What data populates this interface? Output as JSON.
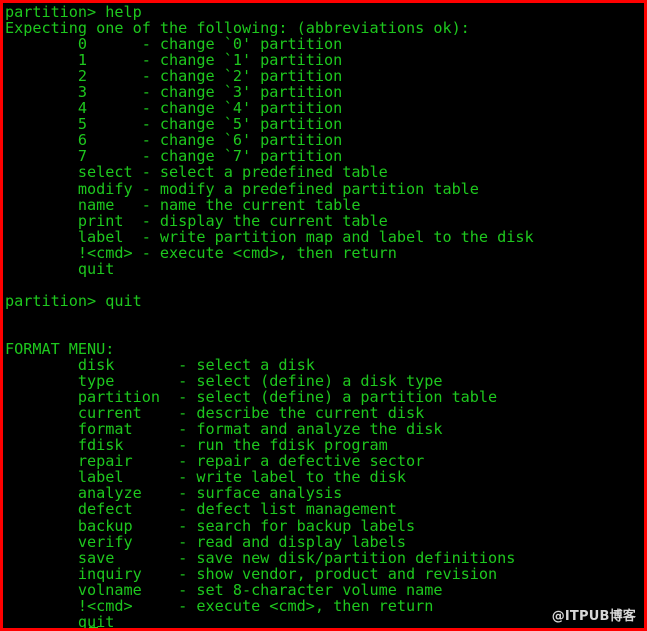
{
  "window": {
    "type": "terminal-emulator",
    "border_color": "#ff0000",
    "background_color": "#000000",
    "foreground_color": "#1ec81e"
  },
  "watermark": {
    "text": "@ITPUB博客",
    "color": "#d8d8d8"
  },
  "terminal": {
    "prompt_label": "partition>",
    "lines": [
      "partition> help",
      "Expecting one of the following: (abbreviations ok):",
      "        0      - change `0' partition",
      "        1      - change `1' partition",
      "        2      - change `2' partition",
      "        3      - change `3' partition",
      "        4      - change `4' partition",
      "        5      - change `5' partition",
      "        6      - change `6' partition",
      "        7      - change `7' partition",
      "        select - select a predefined table",
      "        modify - modify a predefined partition table",
      "        name   - name the current table",
      "        print  - display the current table",
      "        label  - write partition map and label to the disk",
      "        !<cmd> - execute <cmd>, then return",
      "        quit",
      "",
      "partition> quit",
      "",
      "",
      "FORMAT MENU:",
      "        disk       - select a disk",
      "        type       - select (define) a disk type",
      "        partition  - select (define) a partition table",
      "        current    - describe the current disk",
      "        format     - format and analyze the disk",
      "        fdisk      - run the fdisk program",
      "        repair     - repair a defective sector",
      "        label      - write label to the disk",
      "        analyze    - surface analysis",
      "        defect     - defect list management",
      "        backup     - search for backup labels",
      "        verify     - read and display labels",
      "        save       - save new disk/partition definitions",
      "        inquiry    - show vendor, product and revision",
      "        volname    - set 8-character volume name",
      "        !<cmd>     - execute <cmd>, then return",
      "        quit"
    ],
    "commands_partition_menu": [
      {
        "command": "0",
        "description": "change `0' partition"
      },
      {
        "command": "1",
        "description": "change `1' partition"
      },
      {
        "command": "2",
        "description": "change `2' partition"
      },
      {
        "command": "3",
        "description": "change `3' partition"
      },
      {
        "command": "4",
        "description": "change `4' partition"
      },
      {
        "command": "5",
        "description": "change `5' partition"
      },
      {
        "command": "6",
        "description": "change `6' partition"
      },
      {
        "command": "7",
        "description": "change `7' partition"
      },
      {
        "command": "select",
        "description": "select a predefined table"
      },
      {
        "command": "modify",
        "description": "modify a predefined partition table"
      },
      {
        "command": "name",
        "description": "name the current table"
      },
      {
        "command": "print",
        "description": "display the current table"
      },
      {
        "command": "label",
        "description": "write partition map and label to the disk"
      },
      {
        "command": "!<cmd>",
        "description": "execute <cmd>, then return"
      },
      {
        "command": "quit",
        "description": ""
      }
    ],
    "format_menu_title": "FORMAT MENU:",
    "commands_format_menu": [
      {
        "command": "disk",
        "description": "select a disk"
      },
      {
        "command": "type",
        "description": "select (define) a disk type"
      },
      {
        "command": "partition",
        "description": "select (define) a partition table"
      },
      {
        "command": "current",
        "description": "describe the current disk"
      },
      {
        "command": "format",
        "description": "format and analyze the disk"
      },
      {
        "command": "fdisk",
        "description": "run the fdisk program"
      },
      {
        "command": "repair",
        "description": "repair a defective sector"
      },
      {
        "command": "label",
        "description": "write label to the disk"
      },
      {
        "command": "analyze",
        "description": "surface analysis"
      },
      {
        "command": "defect",
        "description": "defect list management"
      },
      {
        "command": "backup",
        "description": "search for backup labels"
      },
      {
        "command": "verify",
        "description": "read and display labels"
      },
      {
        "command": "save",
        "description": "save new disk/partition definitions"
      },
      {
        "command": "inquiry",
        "description": "show vendor, product and revision"
      },
      {
        "command": "volname",
        "description": "set 8-character volume name"
      },
      {
        "command": "!<cmd>",
        "description": "execute <cmd>, then return"
      },
      {
        "command": "quit",
        "description": ""
      }
    ],
    "typed_commands": [
      "help",
      "quit"
    ]
  }
}
